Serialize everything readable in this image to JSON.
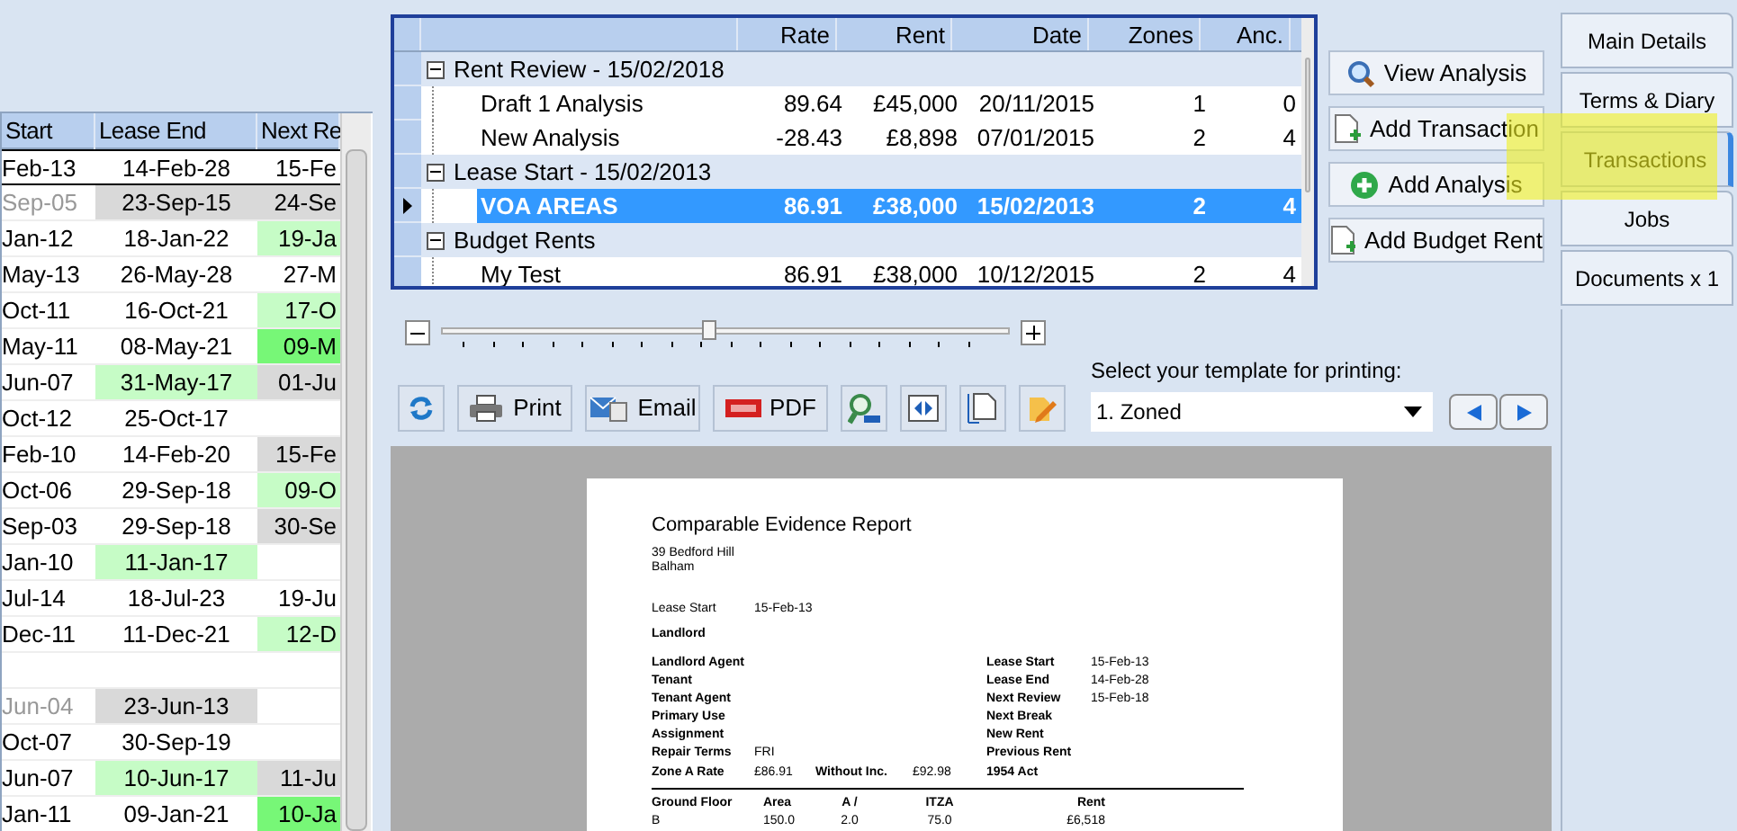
{
  "lease_grid": {
    "columns": [
      "Start",
      "Lease End",
      "Next Re"
    ],
    "rows": [
      {
        "selected": true,
        "dimmed": false,
        "cells": [
          {
            "text": "Feb-13"
          },
          {
            "text": "14-Feb-28"
          },
          {
            "text": "15-Fe"
          }
        ]
      },
      {
        "selected": false,
        "dimmed": true,
        "cells": [
          {
            "text": "Sep-05"
          },
          {
            "text": "23-Sep-15",
            "color": "#d9d9d9"
          },
          {
            "text": "24-Se",
            "color": "#d9d9d9"
          }
        ]
      },
      {
        "selected": false,
        "dimmed": false,
        "cells": [
          {
            "text": "Jan-12"
          },
          {
            "text": "18-Jan-22"
          },
          {
            "text": "19-Ja",
            "color": "#c6fcc6"
          }
        ]
      },
      {
        "selected": false,
        "dimmed": false,
        "cells": [
          {
            "text": "May-13"
          },
          {
            "text": "26-May-28"
          },
          {
            "text": "27-M"
          }
        ]
      },
      {
        "selected": false,
        "dimmed": false,
        "cells": [
          {
            "text": "Oct-11"
          },
          {
            "text": "16-Oct-21"
          },
          {
            "text": "17-O",
            "color": "#c6fcc6"
          }
        ]
      },
      {
        "selected": false,
        "dimmed": false,
        "cells": [
          {
            "text": "May-11"
          },
          {
            "text": "08-May-21"
          },
          {
            "text": "09-M",
            "color": "#77f777"
          }
        ]
      },
      {
        "selected": false,
        "dimmed": false,
        "cells": [
          {
            "text": "Jun-07"
          },
          {
            "text": "31-May-17",
            "color": "#c6fcc6"
          },
          {
            "text": "01-Ju",
            "color": "#d9d9d9"
          }
        ]
      },
      {
        "selected": false,
        "dimmed": false,
        "cells": [
          {
            "text": "Oct-12"
          },
          {
            "text": "25-Oct-17"
          }
        ]
      },
      {
        "selected": false,
        "dimmed": false,
        "cells": [
          {
            "text": "Feb-10"
          },
          {
            "text": "14-Feb-20"
          },
          {
            "text": "15-Fe",
            "color": "#d9d9d9"
          }
        ]
      },
      {
        "selected": false,
        "dimmed": false,
        "cells": [
          {
            "text": "Oct-06"
          },
          {
            "text": "29-Sep-18"
          },
          {
            "text": "09-O",
            "color": "#c6fcc6"
          }
        ]
      },
      {
        "selected": false,
        "dimmed": false,
        "cells": [
          {
            "text": "Sep-03"
          },
          {
            "text": "29-Sep-18"
          },
          {
            "text": "30-Se",
            "color": "#d9d9d9"
          }
        ]
      },
      {
        "selected": false,
        "dimmed": false,
        "cells": [
          {
            "text": "Jan-10"
          },
          {
            "text": "11-Jan-17",
            "color": "#c6fcc6"
          }
        ]
      },
      {
        "selected": false,
        "dimmed": false,
        "cells": [
          {
            "text": "Jul-14"
          },
          {
            "text": "18-Jul-23"
          },
          {
            "text": "19-Ju"
          }
        ]
      },
      {
        "selected": false,
        "dimmed": false,
        "cells": [
          {
            "text": "Dec-11"
          },
          {
            "text": "11-Dec-21"
          },
          {
            "text": "12-D",
            "color": "#c6fcc6"
          }
        ]
      },
      {
        "selected": false
      },
      {
        "selected": false,
        "dimmed": true,
        "cells": [
          {
            "text": "Jun-04"
          },
          {
            "text": "23-Jun-13",
            "color": "#d9d9d9"
          }
        ]
      },
      {
        "selected": false,
        "dimmed": false,
        "cells": [
          {
            "text": "Oct-07"
          },
          {
            "text": "30-Sep-19"
          }
        ]
      },
      {
        "selected": false,
        "dimmed": false,
        "cells": [
          {
            "text": "Jun-07"
          },
          {
            "text": "10-Jun-17",
            "color": "#c6fcc6"
          },
          {
            "text": "11-Ju",
            "color": "#d9d9d9"
          }
        ]
      },
      {
        "selected": false,
        "dimmed": false,
        "cells": [
          {
            "text": "Jan-11"
          },
          {
            "text": "09-Jan-21"
          },
          {
            "text": "10-Ja",
            "color": "#77f777"
          }
        ]
      }
    ]
  },
  "transactions": {
    "columns": [
      "Rate",
      "Rent",
      "Date",
      "Zones",
      "Anc."
    ],
    "groups": [
      {
        "label": "Rent Review - 15/02/2018",
        "expanded": true,
        "children": [
          {
            "name": "Draft 1 Analysis",
            "values": [
              "89.64",
              "£45,000",
              "20/11/2015",
              "1",
              "0"
            ],
            "selected": false
          },
          {
            "name": "New Analysis",
            "values": [
              "-28.43",
              "£8,898",
              "07/01/2015",
              "2",
              "4"
            ],
            "selected": false
          }
        ]
      },
      {
        "label": "Lease Start - 15/02/2013",
        "expanded": true,
        "children": [
          {
            "name": "VOA AREAS",
            "values": [
              "86.91",
              "£38,000",
              "15/02/2013",
              "2",
              "4"
            ],
            "selected": true
          }
        ]
      },
      {
        "label": "Budget Rents",
        "expanded": true,
        "children": [
          {
            "name": "My Test",
            "values": [
              "86.91",
              "£38,000",
              "10/12/2015",
              "2",
              "4"
            ],
            "selected": false
          }
        ]
      }
    ]
  },
  "actions": [
    {
      "kind": "view",
      "label": "View Analysis"
    },
    {
      "kind": "add_doc",
      "label": "Add Transaction"
    },
    {
      "kind": "add",
      "label": "Add Analysis"
    },
    {
      "kind": "add_doc",
      "label": "Add Budget Rent"
    }
  ],
  "tabs": [
    {
      "label": "Main Details",
      "selected": false
    },
    {
      "label": "Terms & Diary",
      "selected": false
    },
    {
      "label": "Transactions",
      "selected": true
    },
    {
      "label": "Jobs",
      "selected": false
    },
    {
      "label": "Documents x 1",
      "selected": false
    }
  ],
  "zoom_slider": {
    "level": 0.47
  },
  "toolbar": [
    {
      "kind": "refresh"
    },
    {
      "kind": "print",
      "label": "Print"
    },
    {
      "kind": "email",
      "label": "Email"
    },
    {
      "kind": "pdf",
      "label": "PDF"
    },
    {
      "kind": "zoom100"
    },
    {
      "kind": "fit_width"
    },
    {
      "kind": "page"
    },
    {
      "kind": "edit"
    }
  ],
  "template": {
    "label": "Select your template for printing:",
    "value": "1. Zoned"
  },
  "report": {
    "title": "Comparable Evidence Report",
    "address": [
      "39 Bedford Hill",
      "Balham"
    ],
    "lease_start": {
      "label": "Lease Start",
      "value": "15-Feb-13"
    },
    "landlord": "Landlord",
    "left_fields": [
      {
        "label": "Landlord Agent"
      },
      {
        "label": "Tenant"
      },
      {
        "label": "Tenant Agent"
      },
      {
        "label": "Primary Use"
      },
      {
        "label": "Assignment"
      },
      {
        "label": "Repair Terms",
        "value": "FRI"
      }
    ],
    "right_fields": [
      {
        "label": "Lease Start",
        "value": "15-Feb-13"
      },
      {
        "label": "Lease End",
        "value": "14-Feb-28"
      },
      {
        "label": "Next Review",
        "value": "15-Feb-18"
      },
      {
        "label": "Next Break"
      },
      {
        "label": "New Rent"
      },
      {
        "label": "Previous Rent"
      }
    ],
    "zone_row": [
      "Zone A Rate",
      "£86.91",
      "Without Inc.",
      "£92.98",
      "1954 Act"
    ],
    "table_header": [
      "Ground Floor",
      "Area",
      "A /",
      "ITZA",
      "Rent"
    ],
    "table_rows": [
      [
        "B",
        "150.0",
        "2.0",
        "75.0",
        "£6,518"
      ]
    ]
  }
}
